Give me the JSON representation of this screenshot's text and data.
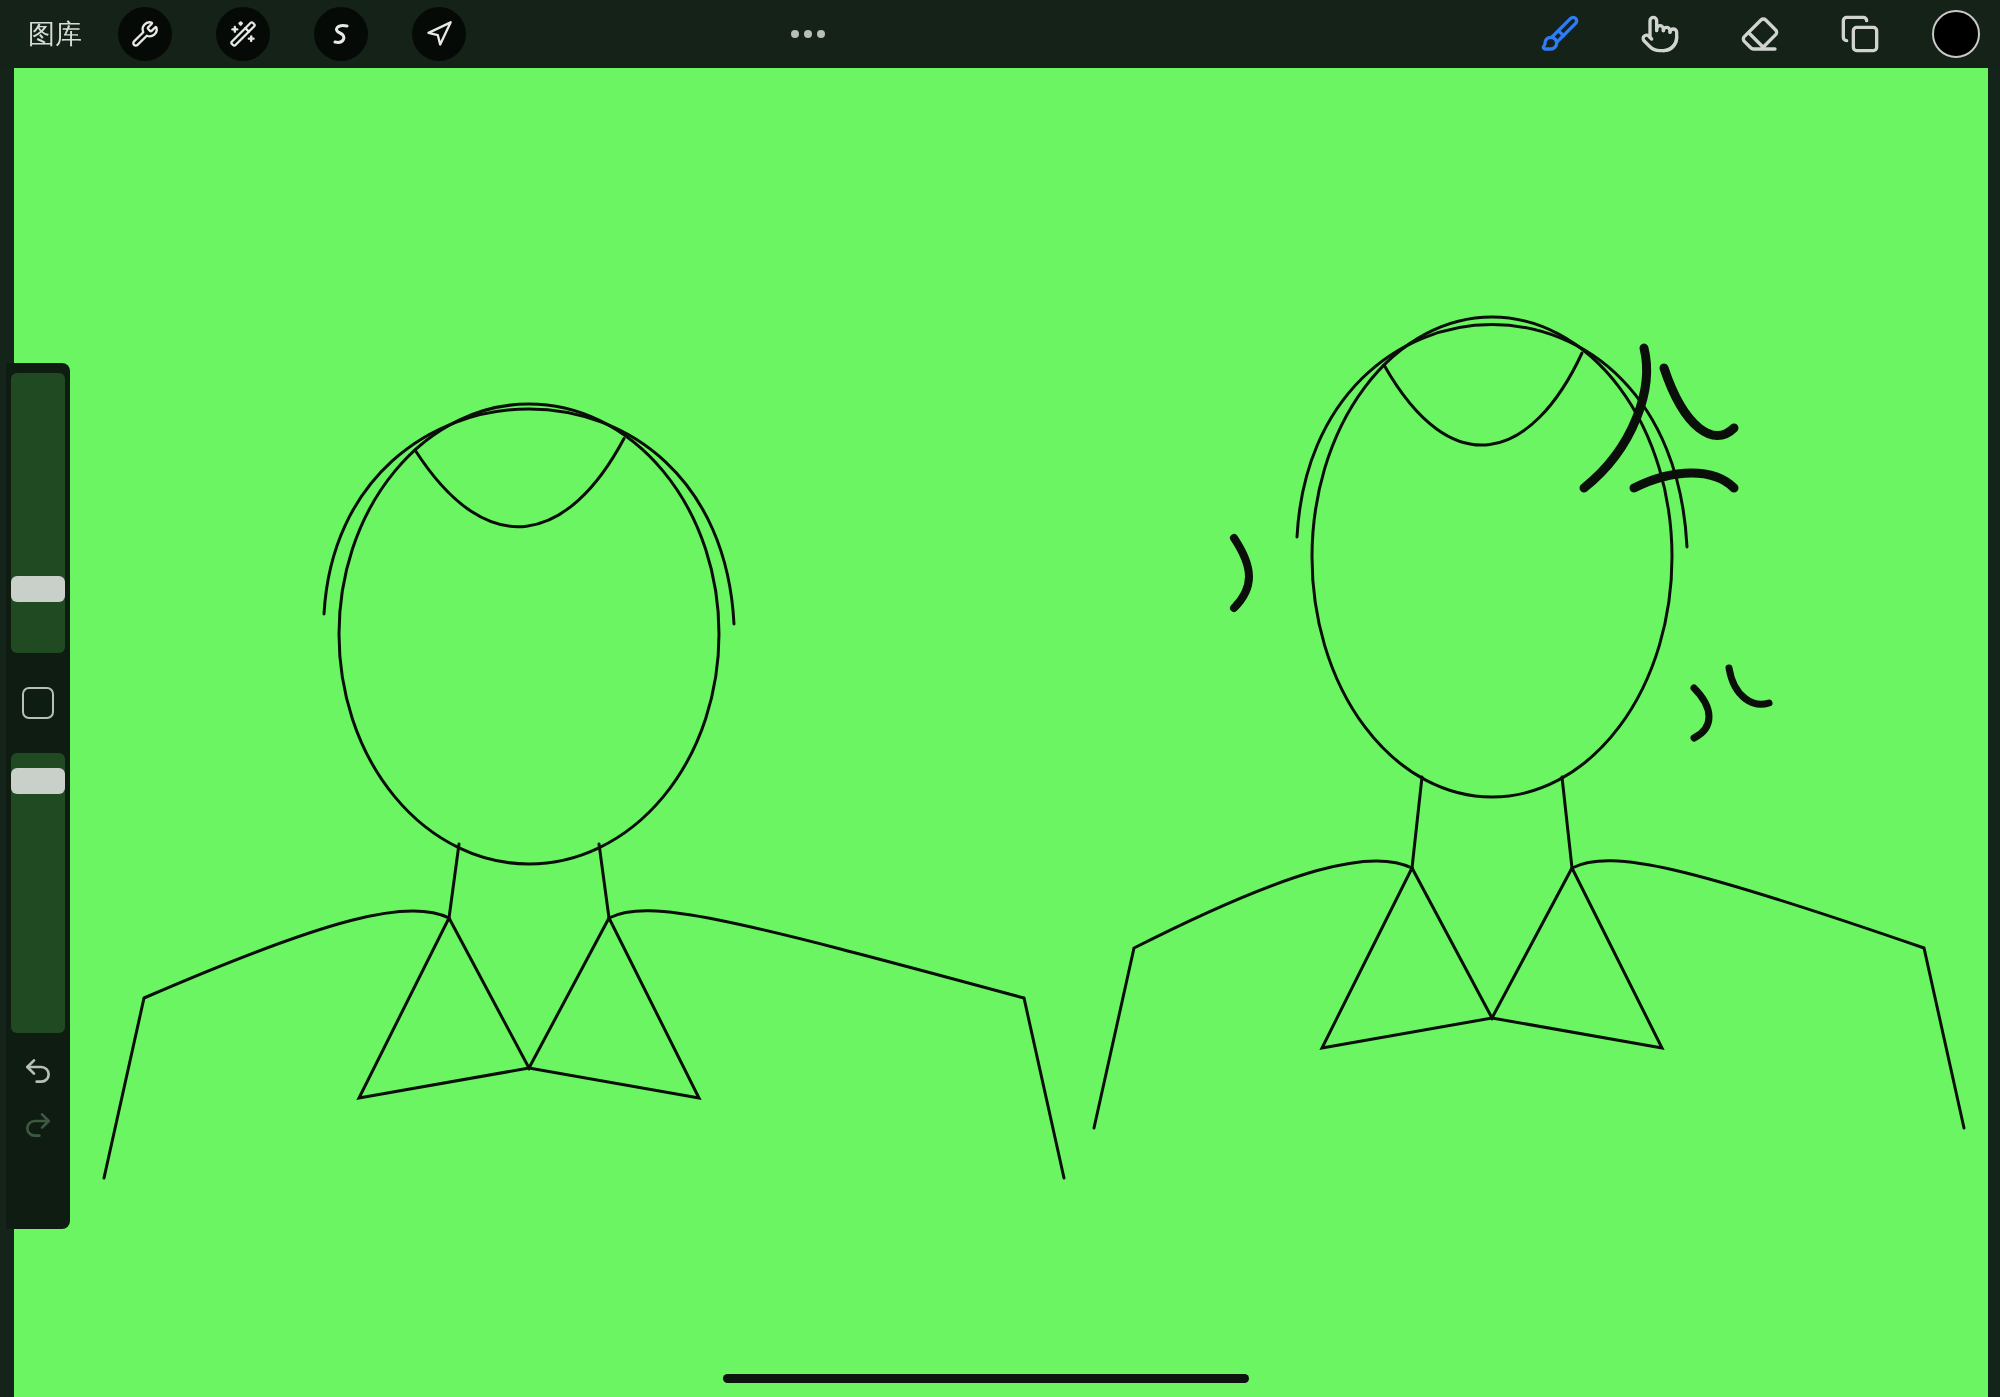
{
  "top_bar": {
    "gallery_label": "图库",
    "left_tools": [
      {
        "kind": "wrench"
      },
      {
        "kind": "wand"
      },
      {
        "kind": "selection"
      },
      {
        "kind": "transform"
      }
    ],
    "right_tools": [
      {
        "kind": "brush",
        "selected": true
      },
      {
        "kind": "smudge",
        "selected": false
      },
      {
        "kind": "eraser",
        "selected": false
      },
      {
        "kind": "layers",
        "selected": false
      }
    ],
    "color": "#000000"
  },
  "sidebar": {
    "size_slider": {
      "level": 0.2
    },
    "opacity_slider": {
      "level": 0.94
    },
    "undo": {
      "disabled": false
    },
    "redo": {
      "disabled": true
    }
  }
}
